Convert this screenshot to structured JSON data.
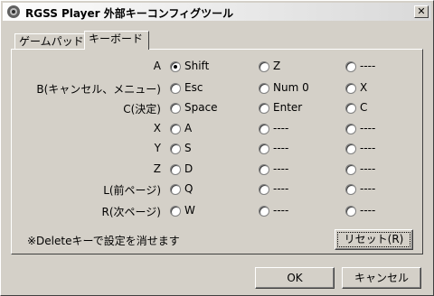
{
  "window": {
    "title": "RGSS Player 外部キーコンフィグツール",
    "close_label": "✕"
  },
  "tabs": [
    {
      "label": "ゲームパッド",
      "active": false
    },
    {
      "label": "キーボード",
      "active": true
    }
  ],
  "rows": [
    {
      "label": "A",
      "selected": 0,
      "options": [
        "Shift",
        "Z",
        "----"
      ]
    },
    {
      "label": "B(キャンセル、メニュー)",
      "selected": null,
      "options": [
        "Esc",
        "Num 0",
        "X"
      ]
    },
    {
      "label": "C(決定)",
      "selected": null,
      "options": [
        "Space",
        "Enter",
        "C"
      ]
    },
    {
      "label": "X",
      "selected": null,
      "options": [
        "A",
        "----",
        "----"
      ]
    },
    {
      "label": "Y",
      "selected": null,
      "options": [
        "S",
        "----",
        "----"
      ]
    },
    {
      "label": "Z",
      "selected": null,
      "options": [
        "D",
        "----",
        "----"
      ]
    },
    {
      "label": "L(前ページ)",
      "selected": null,
      "options": [
        "Q",
        "----",
        "----"
      ]
    },
    {
      "label": "R(次ページ)",
      "selected": null,
      "options": [
        "W",
        "----",
        "----"
      ]
    }
  ],
  "note": "※Deleteキーで設定を消せます",
  "buttons": {
    "reset": "リセット(R)",
    "ok": "OK",
    "cancel": "キャンセル"
  }
}
